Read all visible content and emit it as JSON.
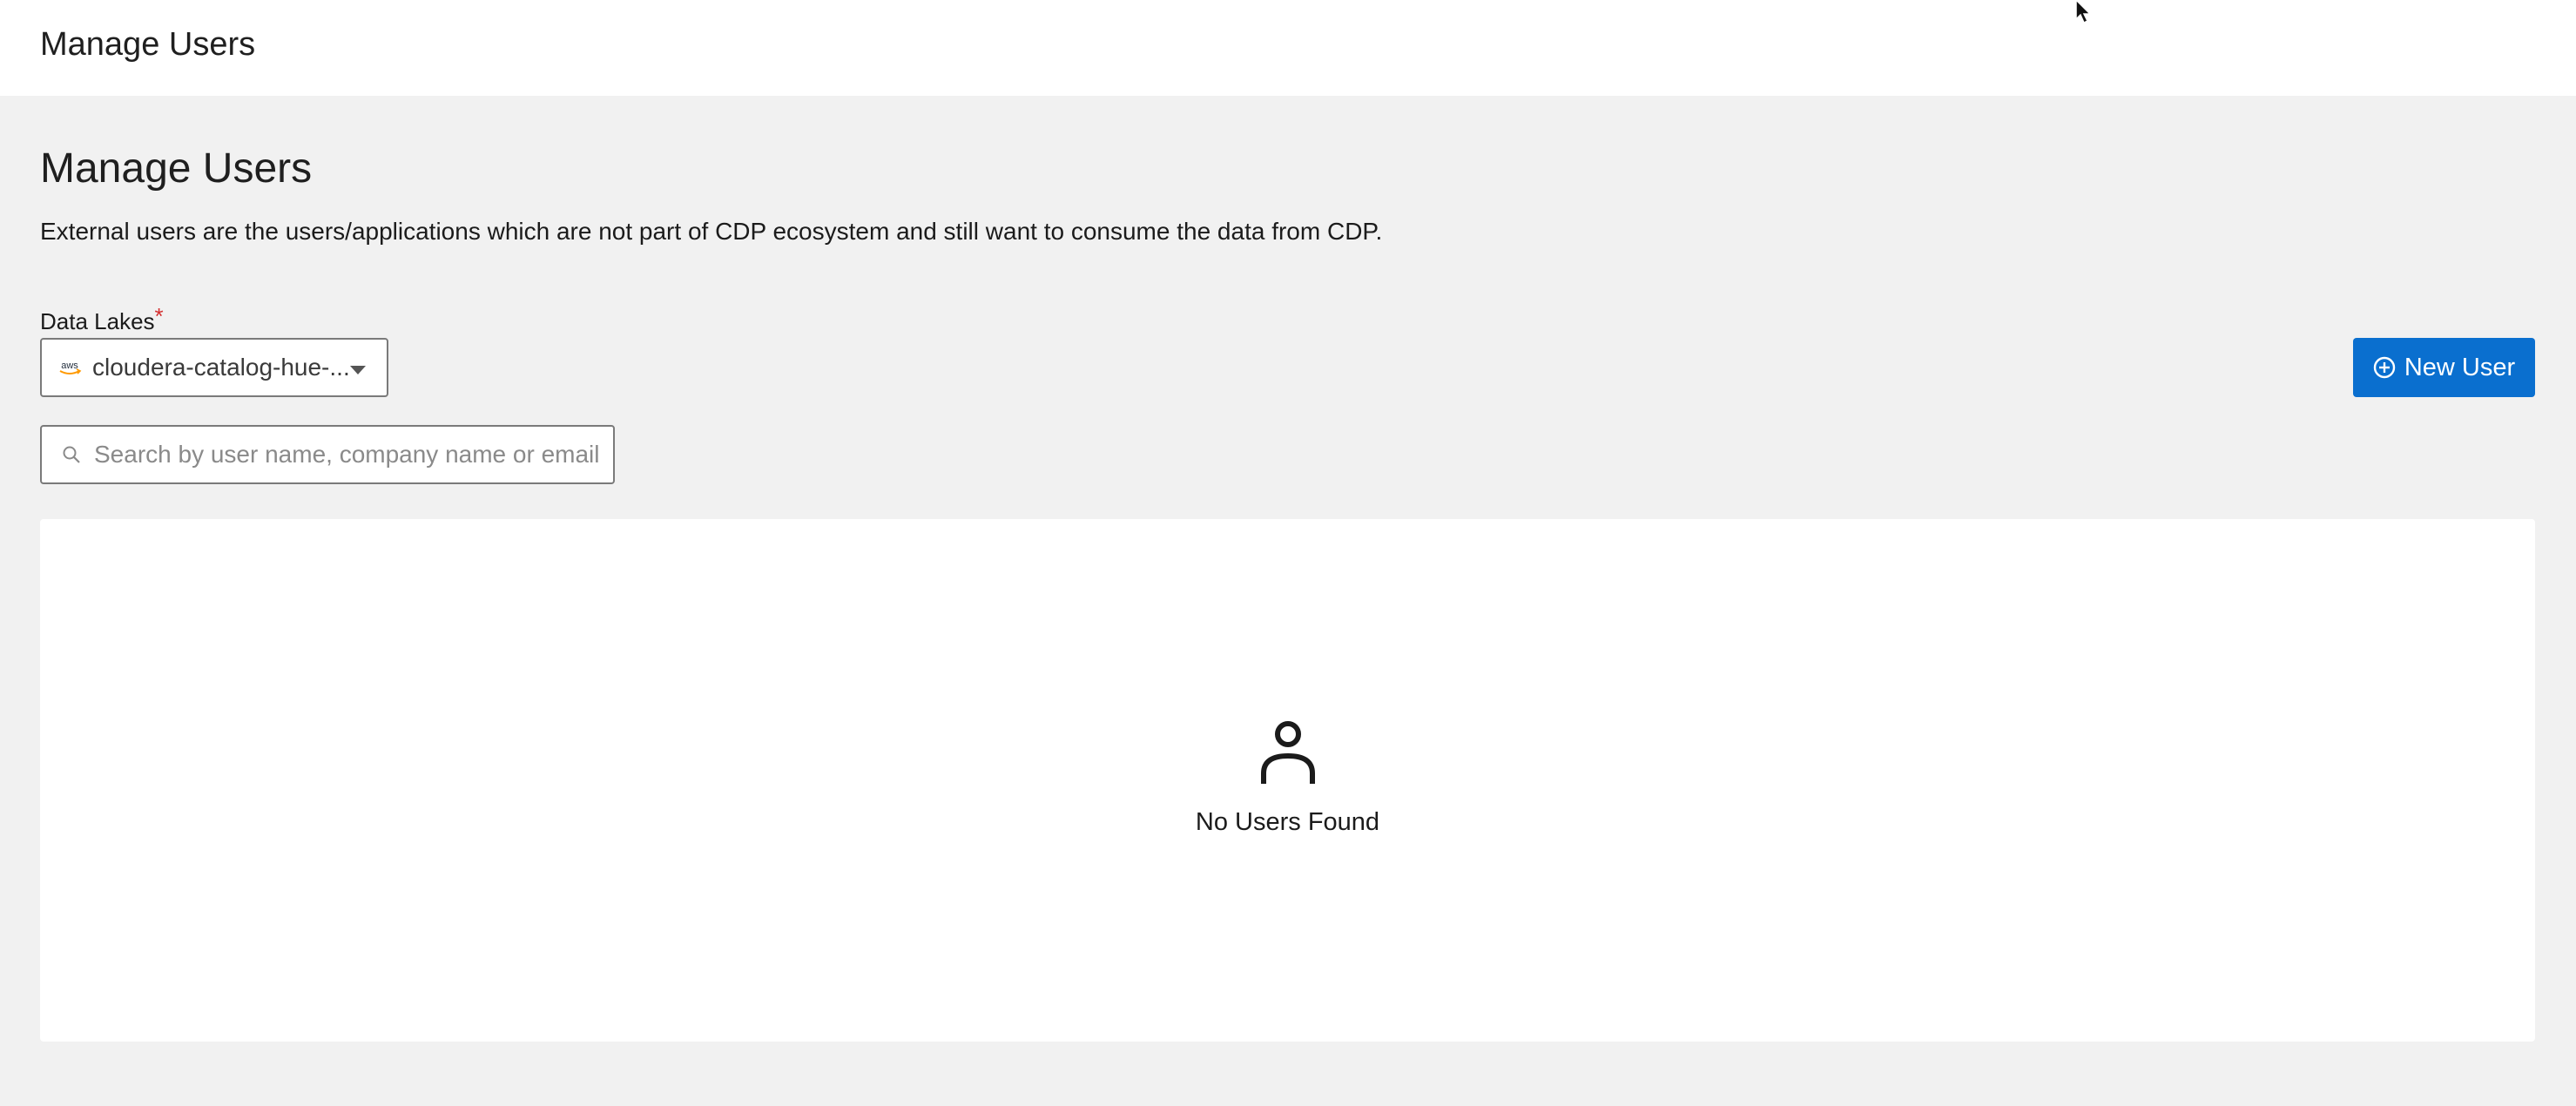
{
  "header": {
    "title": "Manage Users"
  },
  "main": {
    "title": "Manage Users",
    "description": "External users are the users/applications which are not part of CDP ecosystem and still want to consume the data from CDP.",
    "data_lakes": {
      "label": "Data Lakes",
      "required_mark": "*",
      "provider_icon_text": "aws",
      "selected_value": "cloudera-catalog-hue-..."
    },
    "new_user_button": {
      "label": "New User",
      "icon": "plus-circle-icon"
    },
    "search": {
      "placeholder": "Search by user name, company name or email",
      "value": ""
    },
    "empty_state": {
      "icon": "user-icon",
      "message": "No Users Found"
    }
  },
  "colors": {
    "primary": "#0a6fcf",
    "required": "#d32f2f",
    "aws_orange": "#ff9900",
    "background": "#f1f1f1",
    "panel": "#ffffff"
  }
}
